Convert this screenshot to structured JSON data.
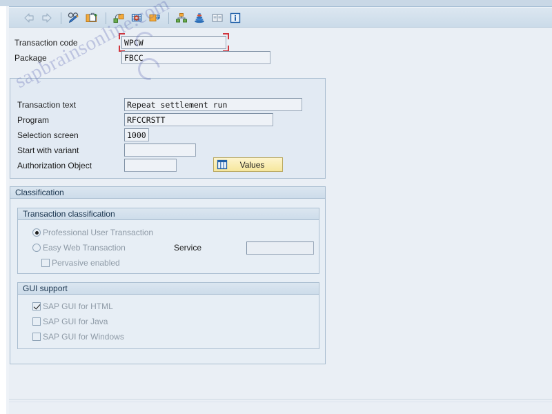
{
  "window": {
    "background_color": "#eaeff5",
    "accent_color": "#d0343c"
  },
  "toolbar": {
    "buttons": [
      {
        "name": "back-icon",
        "title": "Back",
        "glyph": "left-arrow"
      },
      {
        "name": "forward-icon",
        "title": "Forward",
        "glyph": "right-arrow"
      },
      {
        "name": "display-change-icon",
        "title": "Display <-> Change",
        "glyph": "glasses-pencil"
      },
      {
        "name": "other-object-icon",
        "title": "Other object",
        "glyph": "folder-clipboard"
      },
      {
        "name": "copy-object-icon",
        "title": "Copy",
        "glyph": "copy-boxes"
      },
      {
        "name": "delete-object-icon",
        "title": "Delete",
        "glyph": "table-delete"
      },
      {
        "name": "rename-object-icon",
        "title": "Rename",
        "glyph": "box-arrows"
      },
      {
        "name": "where-used-icon",
        "title": "Where-used list",
        "glyph": "hierarchy"
      },
      {
        "name": "stack-icon",
        "title": "Object directory entry",
        "glyph": "stack"
      },
      {
        "name": "documentation-icon",
        "title": "Documentation",
        "glyph": "book"
      },
      {
        "name": "info-icon",
        "title": "Information",
        "glyph": "info"
      }
    ]
  },
  "header_fields": [
    {
      "label": "Transaction code",
      "value": "WPCW",
      "focused": true
    },
    {
      "label": "Package",
      "value": "FBCC",
      "focused": false
    }
  ],
  "attributes": {
    "transaction_text": {
      "label": "Transaction text",
      "value": "Repeat settlement run"
    },
    "program": {
      "label": "Program",
      "value": "RFCCRSTT"
    },
    "selection_screen": {
      "label": "Selection screen",
      "value": "1000"
    },
    "start_with_variant": {
      "label": "Start with variant",
      "value": ""
    },
    "authorization_object": {
      "label": "Authorization Object",
      "value": ""
    },
    "values_button": {
      "label": "Values",
      "icon": "table-values-icon"
    }
  },
  "classification": {
    "title": "Classification",
    "transaction_classification": {
      "title": "Transaction classification",
      "options": [
        {
          "label": "Professional User Transaction",
          "selected": true,
          "enabled": false
        },
        {
          "label": "Easy Web Transaction",
          "selected": false,
          "enabled": false
        }
      ],
      "pervasive": {
        "label": "Pervasive enabled",
        "checked": false,
        "enabled": false
      },
      "service": {
        "label": "Service",
        "value": "",
        "enabled": false
      }
    },
    "gui_support": {
      "title": "GUI support",
      "items": [
        {
          "label": "SAP GUI for HTML",
          "checked": true,
          "enabled": false
        },
        {
          "label": "SAP GUI for Java",
          "checked": false,
          "enabled": false
        },
        {
          "label": "SAP GUI for Windows",
          "checked": false,
          "enabled": false
        }
      ]
    }
  },
  "watermark": {
    "text": "sapbrainsonline.com"
  }
}
